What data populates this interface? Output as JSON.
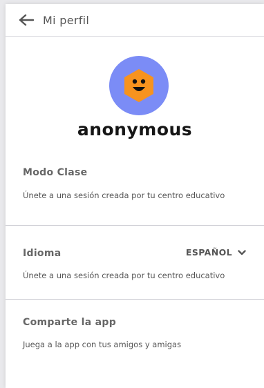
{
  "header": {
    "title": "Mi perfil",
    "back_icon": "arrow-left-icon"
  },
  "profile": {
    "username": "anonymous",
    "avatar_icon": "smiley-hexagon-icon",
    "colors": {
      "avatar_bg": "#7b8cf6",
      "hexagon": "#f7931e"
    }
  },
  "sections": {
    "modo_clase": {
      "title": "Modo Clase",
      "subtitle": "Únete a una sesión creada por tu centro educativo"
    },
    "idioma": {
      "title": "Idioma",
      "subtitle": "Únete a una sesión creada por tu centro educativo",
      "selected_language": "ESPAÑOL",
      "dropdown_icon": "chevron-down-icon"
    },
    "comparte": {
      "title": "Comparte la app",
      "subtitle": "Juega a la app con tus amigos y amigas"
    }
  }
}
